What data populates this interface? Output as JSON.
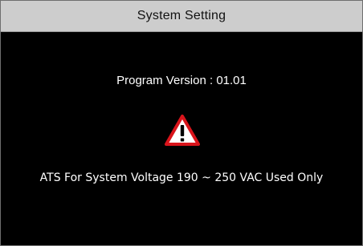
{
  "window": {
    "title": "System Setting"
  },
  "info": {
    "program_version": "Program Version : 01.01",
    "notice": "ATS For System Voltage 190 ~ 250 VAC Used Only"
  },
  "icons": {
    "warning": "warning-triangle-icon"
  },
  "colors": {
    "background": "#000000",
    "title_bar": "#cdcdcd",
    "text": "#ffffff",
    "warning_red": "#d9141b"
  }
}
